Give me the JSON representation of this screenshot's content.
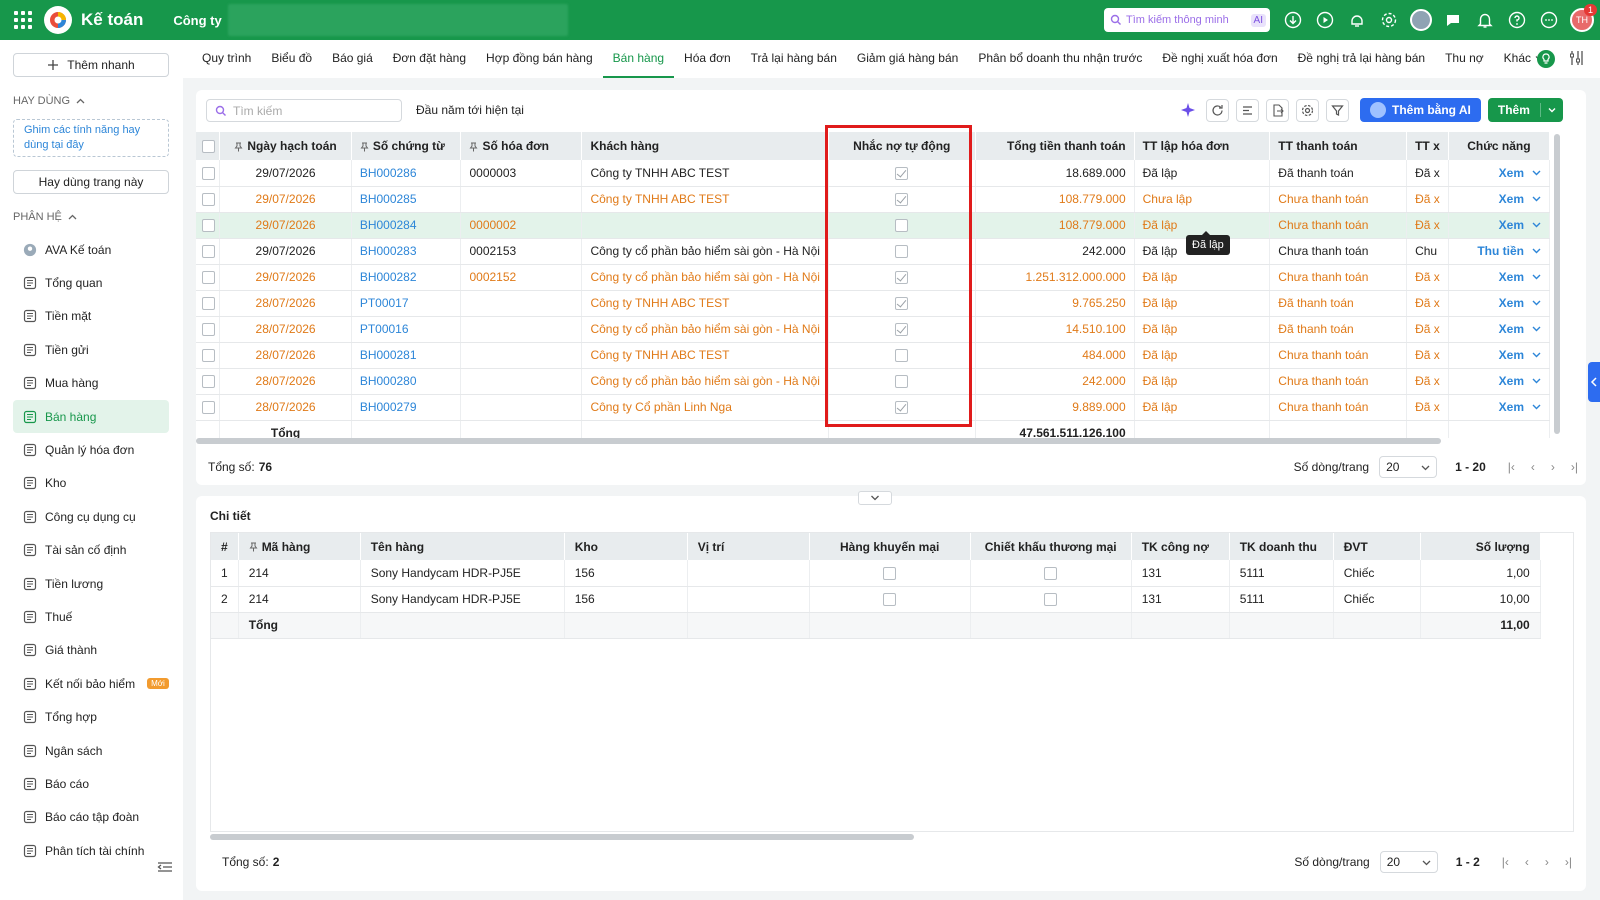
{
  "topbar": {
    "app_title": "Kế toán",
    "company_label": "Công ty",
    "smart_search_placeholder": "Tìm kiếm thông minh",
    "ai_tag": "AI",
    "notif_count": "1",
    "user_initials": "TH",
    "brand_color": "#17974b"
  },
  "sidebar": {
    "add_branch": "Thêm nhanh",
    "favorites_header": "HAY DÙNG",
    "pin_hint": "Ghim các tính năng hay dùng tại đây",
    "use_this_page": "Hay dùng trang này",
    "modules_header": "PHÂN HỆ",
    "new_tag": "Mới",
    "items": [
      {
        "label": "AVA Kế toán",
        "icon": "ava-avatar-icon"
      },
      {
        "label": "Tổng quan",
        "icon": "dashboard-icon"
      },
      {
        "label": "Tiền mặt",
        "icon": "cash-icon"
      },
      {
        "label": "Tiền gửi",
        "icon": "bank-icon"
      },
      {
        "label": "Mua hàng",
        "icon": "shopping-bag-icon"
      },
      {
        "label": "Bán hàng",
        "icon": "cart-icon",
        "active": true
      },
      {
        "label": "Quản lý hóa đơn",
        "icon": "invoice-icon"
      },
      {
        "label": "Kho",
        "icon": "warehouse-icon"
      },
      {
        "label": "Công cụ dụng cụ",
        "icon": "tools-icon"
      },
      {
        "label": "Tài sản cố định",
        "icon": "asset-icon"
      },
      {
        "label": "Tiền lương",
        "icon": "salary-icon"
      },
      {
        "label": "Thuế",
        "icon": "tax-icon"
      },
      {
        "label": "Giá thành",
        "icon": "price-tag-icon"
      },
      {
        "label": "Kết nối bảo hiểm",
        "icon": "insurance-icon",
        "new": true
      },
      {
        "label": "Tổng hợp",
        "icon": "summary-icon"
      },
      {
        "label": "Ngân sách",
        "icon": "budget-icon"
      },
      {
        "label": "Báo cáo",
        "icon": "report-icon"
      },
      {
        "label": "Báo cáo tập đoàn",
        "icon": "group-report-icon"
      },
      {
        "label": "Phân tích tài chính",
        "icon": "analytics-icon"
      }
    ]
  },
  "tabs": [
    {
      "label": "Quy trình"
    },
    {
      "label": "Biểu đồ"
    },
    {
      "label": "Báo giá"
    },
    {
      "label": "Đơn đặt hàng"
    },
    {
      "label": "Hợp đồng bán hàng"
    },
    {
      "label": "Bán hàng",
      "active": true
    },
    {
      "label": "Hóa đơn"
    },
    {
      "label": "Trả lại hàng bán"
    },
    {
      "label": "Giảm giá hàng bán"
    },
    {
      "label": "Phân bổ doanh thu nhận trước"
    },
    {
      "label": "Đề nghị xuất hóa đơn"
    },
    {
      "label": "Đề nghị trả lại hàng bán"
    },
    {
      "label": "Thu nợ"
    },
    {
      "label": "Khác"
    }
  ],
  "list": {
    "search_placeholder": "Tìm kiếm",
    "period": "Đầu năm tới hiện tại",
    "ai_add_button": "Thêm bằng AI",
    "add_button": "Thêm",
    "columns": [
      "Ngày hạch toán",
      "Số chứng từ",
      "Số hóa đơn",
      "Khách hàng",
      "Nhắc nợ tự động",
      "Tổng tiền thanh toán",
      "TT lập hóa đơn",
      "TT thanh toán",
      "TT x",
      "Chức năng"
    ],
    "rows": [
      {
        "date": "29/07/2026",
        "voucher": "BH000286",
        "invoice": "0000003",
        "customer": "Công ty TNHH ABC TEST",
        "auto_remind": true,
        "total": "18.689.000",
        "invoice_status": "Đã lập",
        "pay_status": "Đã thanh toán",
        "tt": "Đã x",
        "action": "Xem",
        "style": "normal"
      },
      {
        "date": "29/07/2026",
        "voucher": "BH000285",
        "invoice": "",
        "customer": "Công ty TNHH ABC TEST",
        "auto_remind": true,
        "total": "108.779.000",
        "invoice_status": "Chưa lập",
        "pay_status": "Chưa thanh toán",
        "tt": "Đã x",
        "action": "Xem",
        "style": "orange"
      },
      {
        "date": "29/07/2026",
        "voucher": "BH000284",
        "invoice": "0000002",
        "customer": "",
        "auto_remind": false,
        "total": "108.779.000",
        "invoice_status": "Đã lập",
        "pay_status": "Chưa thanh toán",
        "tt": "Đã x",
        "action": "Xem",
        "style": "orange-sel"
      },
      {
        "date": "29/07/2026",
        "voucher": "BH000283",
        "invoice": "0002153",
        "customer": "Công ty cổ phần bảo hiểm sài gòn - Hà Nội",
        "auto_remind": false,
        "total": "242.000",
        "invoice_status": "Đã lập",
        "pay_status": "Chưa thanh toán",
        "tt": "Chu",
        "action": "Thu tiền",
        "style": "normal"
      },
      {
        "date": "29/07/2026",
        "voucher": "BH000282",
        "invoice": "0002152",
        "customer": "Công ty cổ phần bảo hiểm sài gòn - Hà Nội",
        "auto_remind": true,
        "total": "1.251.312.000.000",
        "invoice_status": "Đã lập",
        "pay_status": "Chưa thanh toán",
        "tt": "Đã x",
        "action": "Xem",
        "style": "orange"
      },
      {
        "date": "28/07/2026",
        "voucher": "PT00017",
        "invoice": "",
        "customer": "Công ty TNHH ABC TEST",
        "auto_remind": true,
        "total": "9.765.250",
        "invoice_status": "Đã lập",
        "pay_status": "Đã thanh toán",
        "tt": "Đã x",
        "action": "Xem",
        "style": "orange"
      },
      {
        "date": "28/07/2026",
        "voucher": "PT00016",
        "invoice": "",
        "customer": "Công ty cổ phần bảo hiểm sài gòn - Hà Nội",
        "auto_remind": true,
        "total": "14.510.100",
        "invoice_status": "Đã lập",
        "pay_status": "Đã thanh toán",
        "tt": "Đã x",
        "action": "Xem",
        "style": "orange"
      },
      {
        "date": "28/07/2026",
        "voucher": "BH000281",
        "invoice": "",
        "customer": "Công ty TNHH ABC TEST",
        "auto_remind": false,
        "total": "484.000",
        "invoice_status": "Đã lập",
        "pay_status": "Chưa thanh toán",
        "tt": "Đã x",
        "action": "Xem",
        "style": "orange"
      },
      {
        "date": "28/07/2026",
        "voucher": "BH000280",
        "invoice": "",
        "customer": "Công ty cổ phần bảo hiểm sài gòn - Hà Nội",
        "auto_remind": false,
        "total": "242.000",
        "invoice_status": "Đã lập",
        "pay_status": "Chưa thanh toán",
        "tt": "Đã x",
        "action": "Xem",
        "style": "orange"
      },
      {
        "date": "28/07/2026",
        "voucher": "BH000279",
        "invoice": "",
        "customer": "Công ty Cổ phần Linh Nga",
        "auto_remind": true,
        "total": "9.889.000",
        "invoice_status": "Đã lập",
        "pay_status": "Chưa thanh toán",
        "tt": "Đã x",
        "action": "Xem",
        "style": "orange"
      }
    ],
    "total_label": "Tổng",
    "total_value": "47.561.511.126.100",
    "tooltip": "Đã lập",
    "count_label": "Tổng số:",
    "count_value": "76",
    "rows_per_page_label": "Số dòng/trang",
    "rows_per_page": "20",
    "range": "1 - 20"
  },
  "detail": {
    "title": "Chi tiết",
    "columns": [
      "#",
      "Mã hàng",
      "Tên hàng",
      "Kho",
      "Vị trí",
      "Hàng khuyến mại",
      "Chiết khấu thương mại",
      "TK công nợ",
      "TK doanh thu",
      "ĐVT",
      "Số lượng"
    ],
    "rows": [
      {
        "no": "1",
        "code": "214",
        "name": "Sony Handycam HDR-PJ5E",
        "warehouse": "156",
        "location": "",
        "promo": false,
        "discount": false,
        "tk_debt": "131",
        "tk_revenue": "5111",
        "unit": "Chiếc",
        "qty": "1,00"
      },
      {
        "no": "2",
        "code": "214",
        "name": "Sony Handycam HDR-PJ5E",
        "warehouse": "156",
        "location": "",
        "promo": false,
        "discount": false,
        "tk_debt": "131",
        "tk_revenue": "5111",
        "unit": "Chiếc",
        "qty": "10,00"
      }
    ],
    "total_label": "Tổng",
    "total_qty": "11,00",
    "count_label": "Tổng số:",
    "count_value": "2",
    "rows_per_page_label": "Số dòng/trang",
    "rows_per_page": "20",
    "range": "1 - 2"
  }
}
